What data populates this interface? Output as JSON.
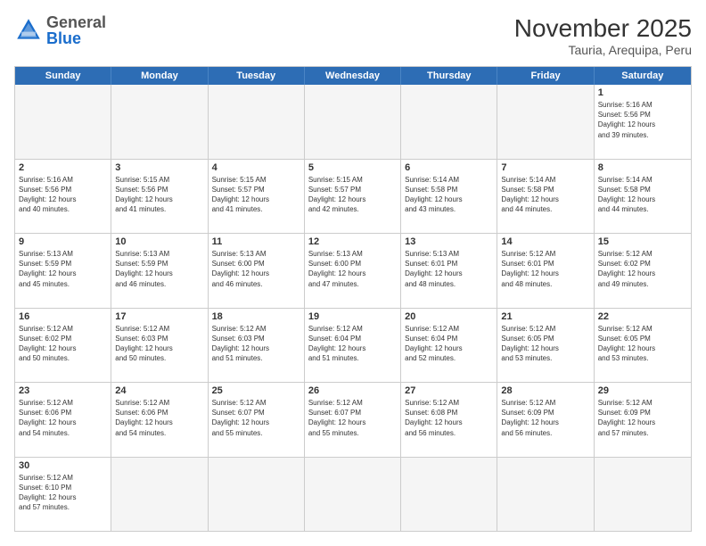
{
  "header": {
    "logo_general": "General",
    "logo_blue": "Blue",
    "month_year": "November 2025",
    "location": "Tauria, Arequipa, Peru"
  },
  "weekdays": [
    "Sunday",
    "Monday",
    "Tuesday",
    "Wednesday",
    "Thursday",
    "Friday",
    "Saturday"
  ],
  "weeks": [
    [
      {
        "day": "",
        "info": ""
      },
      {
        "day": "",
        "info": ""
      },
      {
        "day": "",
        "info": ""
      },
      {
        "day": "",
        "info": ""
      },
      {
        "day": "",
        "info": ""
      },
      {
        "day": "",
        "info": ""
      },
      {
        "day": "1",
        "info": "Sunrise: 5:16 AM\nSunset: 5:56 PM\nDaylight: 12 hours\nand 39 minutes."
      }
    ],
    [
      {
        "day": "2",
        "info": "Sunrise: 5:16 AM\nSunset: 5:56 PM\nDaylight: 12 hours\nand 40 minutes."
      },
      {
        "day": "3",
        "info": "Sunrise: 5:15 AM\nSunset: 5:56 PM\nDaylight: 12 hours\nand 41 minutes."
      },
      {
        "day": "4",
        "info": "Sunrise: 5:15 AM\nSunset: 5:57 PM\nDaylight: 12 hours\nand 41 minutes."
      },
      {
        "day": "5",
        "info": "Sunrise: 5:15 AM\nSunset: 5:57 PM\nDaylight: 12 hours\nand 42 minutes."
      },
      {
        "day": "6",
        "info": "Sunrise: 5:14 AM\nSunset: 5:58 PM\nDaylight: 12 hours\nand 43 minutes."
      },
      {
        "day": "7",
        "info": "Sunrise: 5:14 AM\nSunset: 5:58 PM\nDaylight: 12 hours\nand 44 minutes."
      },
      {
        "day": "8",
        "info": "Sunrise: 5:14 AM\nSunset: 5:58 PM\nDaylight: 12 hours\nand 44 minutes."
      }
    ],
    [
      {
        "day": "9",
        "info": "Sunrise: 5:13 AM\nSunset: 5:59 PM\nDaylight: 12 hours\nand 45 minutes."
      },
      {
        "day": "10",
        "info": "Sunrise: 5:13 AM\nSunset: 5:59 PM\nDaylight: 12 hours\nand 46 minutes."
      },
      {
        "day": "11",
        "info": "Sunrise: 5:13 AM\nSunset: 6:00 PM\nDaylight: 12 hours\nand 46 minutes."
      },
      {
        "day": "12",
        "info": "Sunrise: 5:13 AM\nSunset: 6:00 PM\nDaylight: 12 hours\nand 47 minutes."
      },
      {
        "day": "13",
        "info": "Sunrise: 5:13 AM\nSunset: 6:01 PM\nDaylight: 12 hours\nand 48 minutes."
      },
      {
        "day": "14",
        "info": "Sunrise: 5:12 AM\nSunset: 6:01 PM\nDaylight: 12 hours\nand 48 minutes."
      },
      {
        "day": "15",
        "info": "Sunrise: 5:12 AM\nSunset: 6:02 PM\nDaylight: 12 hours\nand 49 minutes."
      }
    ],
    [
      {
        "day": "16",
        "info": "Sunrise: 5:12 AM\nSunset: 6:02 PM\nDaylight: 12 hours\nand 50 minutes."
      },
      {
        "day": "17",
        "info": "Sunrise: 5:12 AM\nSunset: 6:03 PM\nDaylight: 12 hours\nand 50 minutes."
      },
      {
        "day": "18",
        "info": "Sunrise: 5:12 AM\nSunset: 6:03 PM\nDaylight: 12 hours\nand 51 minutes."
      },
      {
        "day": "19",
        "info": "Sunrise: 5:12 AM\nSunset: 6:04 PM\nDaylight: 12 hours\nand 51 minutes."
      },
      {
        "day": "20",
        "info": "Sunrise: 5:12 AM\nSunset: 6:04 PM\nDaylight: 12 hours\nand 52 minutes."
      },
      {
        "day": "21",
        "info": "Sunrise: 5:12 AM\nSunset: 6:05 PM\nDaylight: 12 hours\nand 53 minutes."
      },
      {
        "day": "22",
        "info": "Sunrise: 5:12 AM\nSunset: 6:05 PM\nDaylight: 12 hours\nand 53 minutes."
      }
    ],
    [
      {
        "day": "23",
        "info": "Sunrise: 5:12 AM\nSunset: 6:06 PM\nDaylight: 12 hours\nand 54 minutes."
      },
      {
        "day": "24",
        "info": "Sunrise: 5:12 AM\nSunset: 6:06 PM\nDaylight: 12 hours\nand 54 minutes."
      },
      {
        "day": "25",
        "info": "Sunrise: 5:12 AM\nSunset: 6:07 PM\nDaylight: 12 hours\nand 55 minutes."
      },
      {
        "day": "26",
        "info": "Sunrise: 5:12 AM\nSunset: 6:07 PM\nDaylight: 12 hours\nand 55 minutes."
      },
      {
        "day": "27",
        "info": "Sunrise: 5:12 AM\nSunset: 6:08 PM\nDaylight: 12 hours\nand 56 minutes."
      },
      {
        "day": "28",
        "info": "Sunrise: 5:12 AM\nSunset: 6:09 PM\nDaylight: 12 hours\nand 56 minutes."
      },
      {
        "day": "29",
        "info": "Sunrise: 5:12 AM\nSunset: 6:09 PM\nDaylight: 12 hours\nand 57 minutes."
      }
    ],
    [
      {
        "day": "30",
        "info": "Sunrise: 5:12 AM\nSunset: 6:10 PM\nDaylight: 12 hours\nand 57 minutes."
      },
      {
        "day": "",
        "info": ""
      },
      {
        "day": "",
        "info": ""
      },
      {
        "day": "",
        "info": ""
      },
      {
        "day": "",
        "info": ""
      },
      {
        "day": "",
        "info": ""
      },
      {
        "day": "",
        "info": ""
      }
    ]
  ]
}
